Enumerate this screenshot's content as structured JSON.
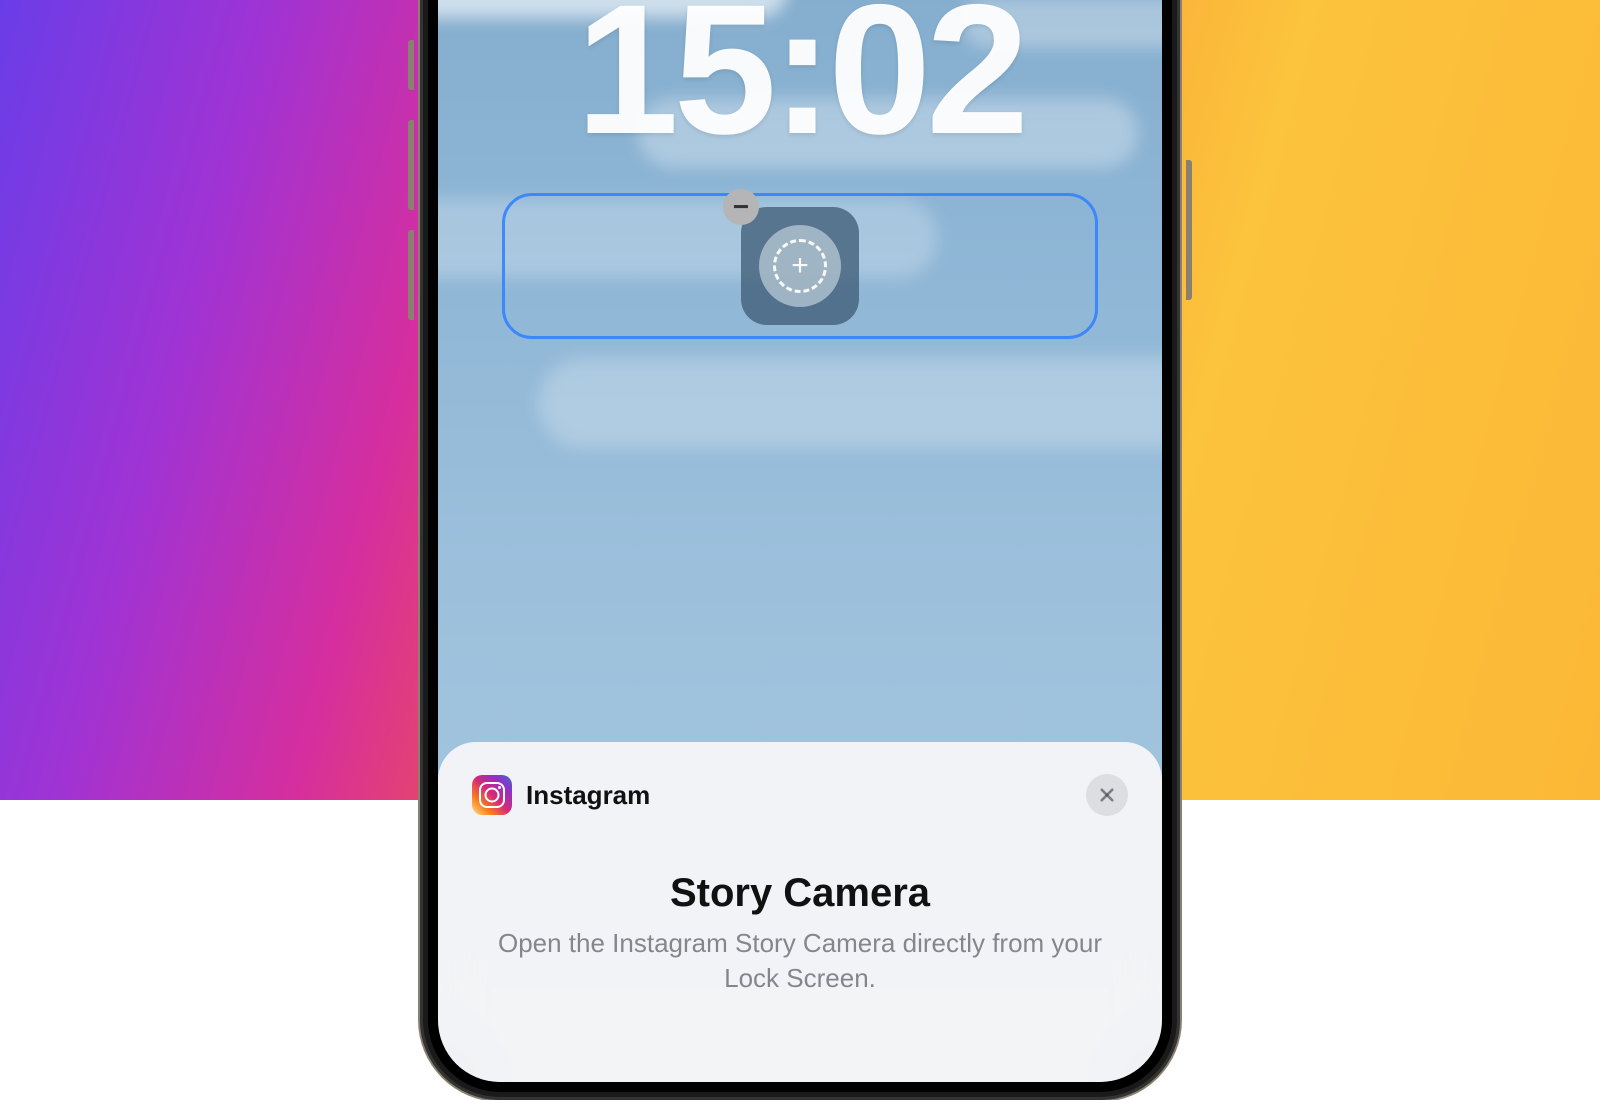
{
  "lockscreen": {
    "time": "15:02"
  },
  "sheet": {
    "app_name": "Instagram",
    "widget_title": "Story Camera",
    "widget_description": "Open the Instagram Story Camera directly from your Lock Screen."
  }
}
